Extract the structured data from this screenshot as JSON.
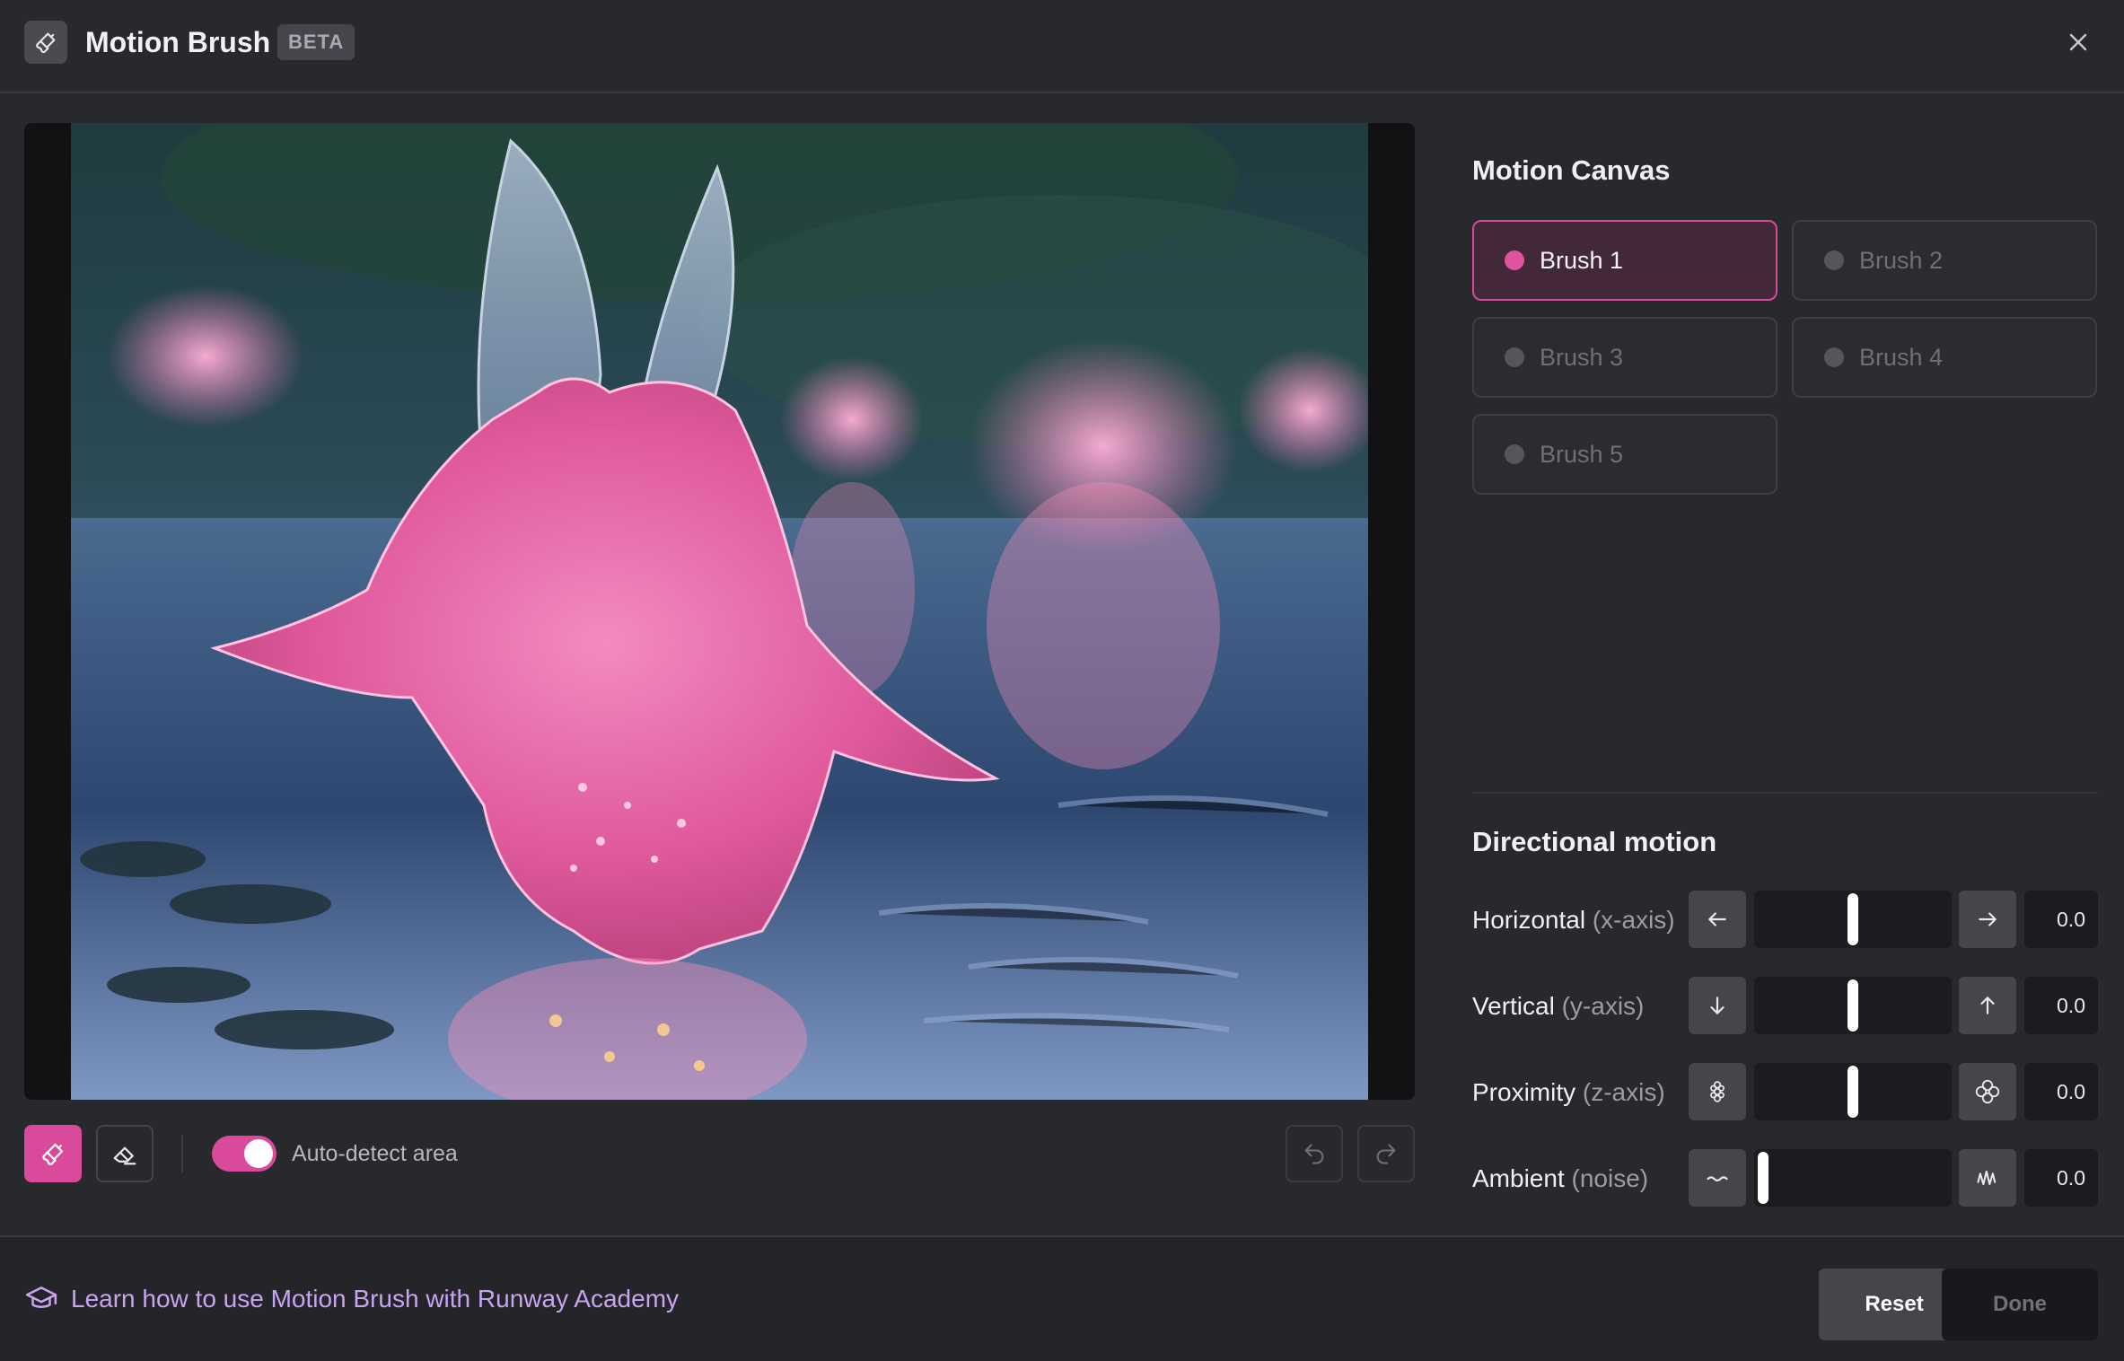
{
  "header": {
    "title": "Motion Brush",
    "badge": "BETA",
    "icon": "brush-icon",
    "close_icon": "close-icon"
  },
  "canvas": {
    "image_description_icon": "image"
  },
  "toolbar": {
    "brush_tool_icon": "brush-icon",
    "eraser_tool_icon": "eraser-icon",
    "auto_detect_label": "Auto-detect area",
    "auto_detect_on": true,
    "undo_icon": "undo-icon",
    "redo_icon": "redo-icon"
  },
  "motion_canvas": {
    "title": "Motion Canvas",
    "brushes": [
      {
        "label": "Brush 1",
        "active": true
      },
      {
        "label": "Brush 2",
        "active": false
      },
      {
        "label": "Brush 3",
        "active": false
      },
      {
        "label": "Brush 4",
        "active": false
      },
      {
        "label": "Brush 5",
        "active": false
      }
    ]
  },
  "directional_motion": {
    "title": "Directional motion",
    "rows": [
      {
        "label": "Horizontal",
        "sub": "(x-axis)",
        "value": "0.0",
        "level": 0.5,
        "left_icon": "arrow-left-icon",
        "right_icon": "arrow-right-icon"
      },
      {
        "label": "Vertical",
        "sub": "(y-axis)",
        "value": "0.0",
        "level": 0.5,
        "left_icon": "arrow-down-icon",
        "right_icon": "arrow-up-icon"
      },
      {
        "label": "Proximity",
        "sub": "(z-axis)",
        "value": "0.0",
        "level": 0.5,
        "left_icon": "small-flower-icon",
        "right_icon": "large-flower-icon"
      },
      {
        "label": "Ambient",
        "sub": "(noise)",
        "value": "0.0",
        "level": 0.0,
        "left_icon": "low-wave-icon",
        "right_icon": "high-wave-icon"
      }
    ]
  },
  "footer": {
    "learn_link": "Learn how to use Motion Brush with Runway Academy",
    "learn_icon": "graduation-cap-icon",
    "reset_label": "Reset",
    "done_label": "Done"
  },
  "colors": {
    "accent": "#d94a9b",
    "background": "#28292d",
    "link": "#c9a3f0"
  }
}
